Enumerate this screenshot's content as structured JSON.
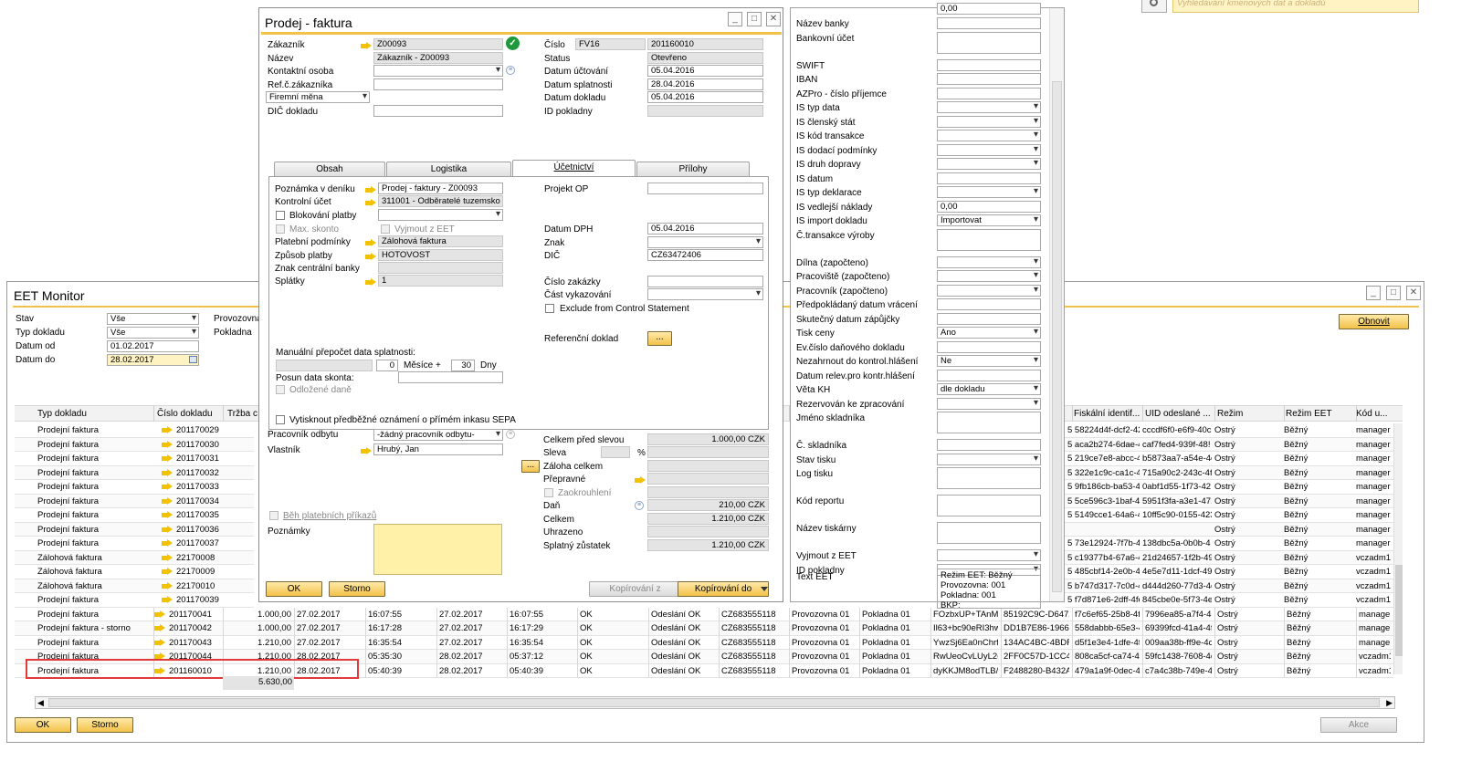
{
  "topbar": {
    "search_placeholder": "Vyhledávání kmenových dat a dokladů"
  },
  "eet": {
    "title": "EET Monitor",
    "filters": {
      "stav_label": "Stav",
      "stav_value": "Vše",
      "typ_label": "Typ dokladu",
      "typ_value": "Vše",
      "od_label": "Datum od",
      "od_value": "01.02.2017",
      "do_label": "Datum do",
      "do_value": "28.02.2017",
      "provozovna_label": "Provozovna",
      "pokladna_label": "Pokladna"
    },
    "refresh_label": "Obnovit",
    "left_headers": [
      "Typ dokladu",
      "Číslo dokladu",
      "Tržba c"
    ],
    "right_headers": [
      "Fiskální identif...",
      "UID odeslané ...",
      "Režim",
      "Režim EET",
      "Kód u..."
    ],
    "left_rows": [
      [
        "Prodejní faktura",
        "201170029"
      ],
      [
        "Prodejní faktura",
        "201170030"
      ],
      [
        "Prodejní faktura",
        "201170031"
      ],
      [
        "Prodejní faktura",
        "201170032"
      ],
      [
        "Prodejní faktura",
        "201170033"
      ],
      [
        "Prodejní faktura",
        "201170034"
      ],
      [
        "Prodejní faktura",
        "201170035"
      ],
      [
        "Prodejní faktura",
        "201170036"
      ],
      [
        "Prodejní faktura",
        "201170037"
      ],
      [
        "Zálohová faktura",
        "22170008"
      ],
      [
        "Zálohová faktura",
        "22170009"
      ],
      [
        "Zálohová faktura",
        "22170010"
      ],
      [
        "Prodejní faktura",
        "201170039"
      ]
    ],
    "right_rows": [
      [
        "5 58224d4f-dcf2-42",
        "cccdf6f0-e6f9-40c",
        "Ostrý",
        "Běžný",
        "manager"
      ],
      [
        "5 aca2b274-6dae-4:",
        "caf7fed4-939f-48!",
        "Ostrý",
        "Běžný",
        "manager"
      ],
      [
        "5 219ce7e8-abcc-4e",
        "b5873aa7-a54e-4c",
        "Ostrý",
        "Běžný",
        "manager"
      ],
      [
        "5 322e1c9c-ca1c-4!",
        "715a90c2-243c-4f",
        "Ostrý",
        "Běžný",
        "manager"
      ],
      [
        "5 9fb186cb-ba53-4!",
        "0abf1d55-1f73-42",
        "Ostrý",
        "Běžný",
        "manager"
      ],
      [
        "5 5ce596c3-1baf-43",
        "5951f3fa-a3e1-471",
        "Ostrý",
        "Běžný",
        "manager"
      ],
      [
        "5 5149cce1-64a6-42",
        "10ff5c90-0155-423",
        "Ostrý",
        "Běžný",
        "manager"
      ],
      [
        "",
        "",
        "Ostrý",
        "Běžný",
        "manager"
      ],
      [
        "5 73e12924-7f7b-4a",
        "138dbc5a-0b0b-4",
        "Ostrý",
        "Běžný",
        "manager"
      ],
      [
        "5 c19377b4-67a6-4(",
        "21d24657-1f2b-49",
        "Ostrý",
        "Běžný",
        "vczadm19"
      ],
      [
        "5 485cbf14-2e0b-4!",
        "4e5e7d11-1dcf-49",
        "Ostrý",
        "Běžný",
        "vczadm19"
      ],
      [
        "5 b747d317-7c0d-4(",
        "d444d260-77d3-4e",
        "Ostrý",
        "Běžný",
        "vczadm19"
      ],
      [
        "5 f7d871e6-2dff-4fe",
        "845cbe0e-5f73-4e",
        "Ostrý",
        "Běžný",
        "vczadm19"
      ]
    ],
    "full_rows": [
      [
        "Prodejní faktura",
        "201170041",
        "1.000,00",
        "27.02.2017",
        "16:07:55",
        "27.02.2017",
        "16:07:55",
        "OK",
        "Odeslání OK",
        "CZ683555118",
        "Provozovna 01",
        "Pokladna 01",
        "FOzbxUP+TAnMI",
        "85192C9C-D6472(",
        "f7c6ef65-25b8-4f5",
        "7996ea85-a7f4-46",
        "Ostrý",
        "Běžný",
        "manager"
      ],
      [
        "Prodejní faktura - storno",
        "201170042",
        "1.000,00",
        "27.02.2017",
        "16:17:28",
        "27.02.2017",
        "16:17:29",
        "OK",
        "Odeslání OK",
        "CZ683555118",
        "Provozovna 01",
        "Pokladna 01",
        "Il63+bc90eRI3hw",
        "DD1B7E86-19662!",
        "558dabbb-65e3-4",
        "69399fcd-41a4-4f(",
        "Ostrý",
        "Běžný",
        "manager"
      ],
      [
        "Prodejní faktura",
        "201170043",
        "1.210,00",
        "27.02.2017",
        "16:35:54",
        "27.02.2017",
        "16:35:54",
        "OK",
        "Odeslání OK",
        "CZ683555118",
        "Provozovna 01",
        "Pokladna 01",
        "YwzSj6Ea0nChrf3",
        "134AC4BC-4BDF(",
        "d5f1e3e4-1dfe-4f",
        "009aa38b-ff9e-4c",
        "Ostrý",
        "Běžný",
        "manager"
      ],
      [
        "Prodejní faktura",
        "201170044",
        "1.210,00",
        "28.02.2017",
        "05:35:30",
        "28.02.2017",
        "05:37:12",
        "OK",
        "Odeslání OK",
        "CZ683555118",
        "Provozovna 01",
        "Pokladna 01",
        "RwUeoCvLUyL2e",
        "2FF0C57D-1CC48",
        "808ca5cf-ca74-4f",
        "59fc1438-7608-4e",
        "Ostrý",
        "Běžný",
        "vczadm19"
      ],
      [
        "Prodejní faktura",
        "201160010",
        "1.210,00",
        "28.02.2017",
        "05:40:39",
        "28.02.2017",
        "05:40:39",
        "OK",
        "Odeslání OK",
        "CZ683555118",
        "Provozovna 01",
        "Pokladna 01",
        "dyKKJM8odTLB//",
        "F2488280-B432A7",
        "479a1a9f-0dec-42",
        "c7a4c38b-749e-4!",
        "Ostrý",
        "Běžný",
        "vczadm19"
      ]
    ],
    "total": "5.630,00",
    "ok_label": "OK",
    "storno_label": "Storno",
    "akce_label": "Akce"
  },
  "invoice": {
    "title": "Prodej - faktura",
    "zakaznik_label": "Zákazník",
    "zakaznik_value": "Z00093",
    "nazev_label": "Název",
    "nazev_value": "Zákazník - Z00093",
    "kontakt_label": "Kontaktní osoba",
    "ref_label": "Ref.č.zákazníka",
    "mena_value": "Firemní měna",
    "dic_label": "DIČ dokladu",
    "cislo_label": "Číslo",
    "cislo_series": "FV16",
    "cislo_value": "201160010",
    "status_label": "Status",
    "status_value": "Otevřeno",
    "ucto_label": "Datum účtování",
    "ucto_value": "05.04.2016",
    "splat_label": "Datum splatnosti",
    "splat_value": "28.04.2016",
    "dokl_label": "Datum dokladu",
    "dokl_value": "05.04.2016",
    "idpokl_label": "ID pokladny",
    "tabs": [
      "Obsah",
      "Logistika",
      "Účetnictví",
      "Přílohy"
    ],
    "acc": {
      "pozn_label": "Poznámka v deníku",
      "pozn_value": "Prodej - faktury - Z00093",
      "kontrol_label": "Kontrolní účet",
      "kontrol_value": "311001 - Odběratelé tuzemsko",
      "blok_label": "Blokování platby",
      "maxsk_label": "Max. skonto",
      "vyjmout_label": "Vyjmout z EET",
      "plat_label": "Platební podmínky",
      "plat_value": "Zálohová faktura",
      "zpusob_label": "Způsob platby",
      "zpusob_value": "HOTOVOST",
      "znakcb_label": "Znak centrální banky",
      "splatky_label": "Splátky",
      "splatky_value": "1",
      "projekt_label": "Projekt OP",
      "dph_label": "Datum DPH",
      "dph_value": "05.04.2016",
      "znak_label": "Znak",
      "dic_label": "DIČ",
      "dic_value": "CZ63472406",
      "zakazka_label": "Číslo zakázky",
      "cast_label": "Část vykazování",
      "exclude_label": "Exclude from Control Statement",
      "ref_label": "Referenční doklad",
      "ref_btn": "...",
      "manual_label": "Manuální přepočet data splatnosti:",
      "manual_zero": "0",
      "mesice_label": "Měsíce +",
      "dny_value": "30",
      "dny_label": "Dny",
      "posun_label": "Posun data skonta:",
      "odloz_label": "Odložené daně",
      "sepa_label": "Vytisknout předběžné oznámení o přímém inkasu SEPA"
    },
    "pracovnik_label": "Pracovník odbytu",
    "pracovnik_value": "-žádný pracovník odbytu-",
    "vlastnik_label": "Vlastník",
    "vlastnik_value": "Hrubý, Jan",
    "beh_label": "Běh platebních příkazů",
    "poznamky_label": "Poznámky",
    "totals": {
      "pred_label": "Celkem před slevou",
      "pred_value": "1.000,00 CZK",
      "sleva_label": "Sleva",
      "pct": "%",
      "zaloha_label": "Záloha celkem",
      "prepravne_label": "Přepravné",
      "zaokr_label": "Zaokrouhlení",
      "dan_label": "Daň",
      "dan_value": "210,00 CZK",
      "celkem_label": "Celkem",
      "celkem_value": "1.210,00 CZK",
      "uhrazeno_label": "Uhrazeno",
      "zustatek_label": "Splatný zůstatek",
      "zustatek_value": "1.210,00 CZK"
    },
    "ok_label": "OK",
    "storno_label": "Storno",
    "kopz_label": "Kopírování z",
    "kopdo_label": "Kopírování do"
  },
  "udf": {
    "top_value": "0,00",
    "rows": [
      {
        "label": "Název banky",
        "type": "text"
      },
      {
        "label": "Bankovní účet",
        "type": "tall"
      },
      {
        "label": "SWIFT",
        "type": "text"
      },
      {
        "label": "IBAN",
        "type": "text"
      },
      {
        "label": "AZPro - číslo příjemce",
        "type": "text"
      },
      {
        "label": "IS typ data",
        "type": "dd"
      },
      {
        "label": "IS členský stát",
        "type": "dd"
      },
      {
        "label": "IS kód transakce",
        "type": "dd"
      },
      {
        "label": "IS dodací podmínky",
        "type": "dd"
      },
      {
        "label": "IS druh dopravy",
        "type": "dd"
      },
      {
        "label": "IS datum",
        "type": "text"
      },
      {
        "label": "IS typ deklarace",
        "type": "dd"
      },
      {
        "label": "IS vedlejší náklady",
        "type": "text",
        "value": "0,00"
      },
      {
        "label": "IS import dokladu",
        "type": "dd",
        "value": "Importovat"
      },
      {
        "label": "Č.transakce výroby",
        "type": "tall"
      },
      {
        "label": "Dílna (započteno)",
        "type": "dd"
      },
      {
        "label": "Pracoviště (započteno)",
        "type": "dd"
      },
      {
        "label": "Pracovník (započteno)",
        "type": "dd"
      },
      {
        "label": "Předpokládaný datum vrácení",
        "type": "text"
      },
      {
        "label": "Skutečný datum zápůjčky",
        "type": "text"
      },
      {
        "label": "Tisk ceny",
        "type": "dd",
        "value": "Ano"
      },
      {
        "label": "Ev.číslo daňového dokladu",
        "type": "text"
      },
      {
        "label": "Nezahrnout do kontrol.hlášení",
        "type": "dd",
        "value": "Ne"
      },
      {
        "label": "Datum relev.pro kontr.hlášení",
        "type": "text"
      },
      {
        "label": "Věta KH",
        "type": "dd",
        "value": "dle dokladu"
      },
      {
        "label": "Rezervován ke zpracování",
        "type": "dd"
      },
      {
        "label": "Jméno skladníka",
        "type": "tall"
      },
      {
        "label": "Č. skladníka",
        "type": "text"
      },
      {
        "label": "Stav tisku",
        "type": "dd"
      },
      {
        "label": "Log tisku",
        "type": "tall"
      },
      {
        "label": "Kód reportu",
        "type": "tall"
      },
      {
        "label": "Název tiskárny",
        "type": "tall"
      },
      {
        "label": "Vyjmout z EET",
        "type": "dd"
      },
      {
        "label": "ID pokladny",
        "type": "dd"
      }
    ],
    "text_eet_label": "Text EET",
    "text_eet_lines": [
      "Režim EET: Běžný",
      "Provozovna: 001",
      "Pokladna: 001",
      "BKP:"
    ]
  }
}
